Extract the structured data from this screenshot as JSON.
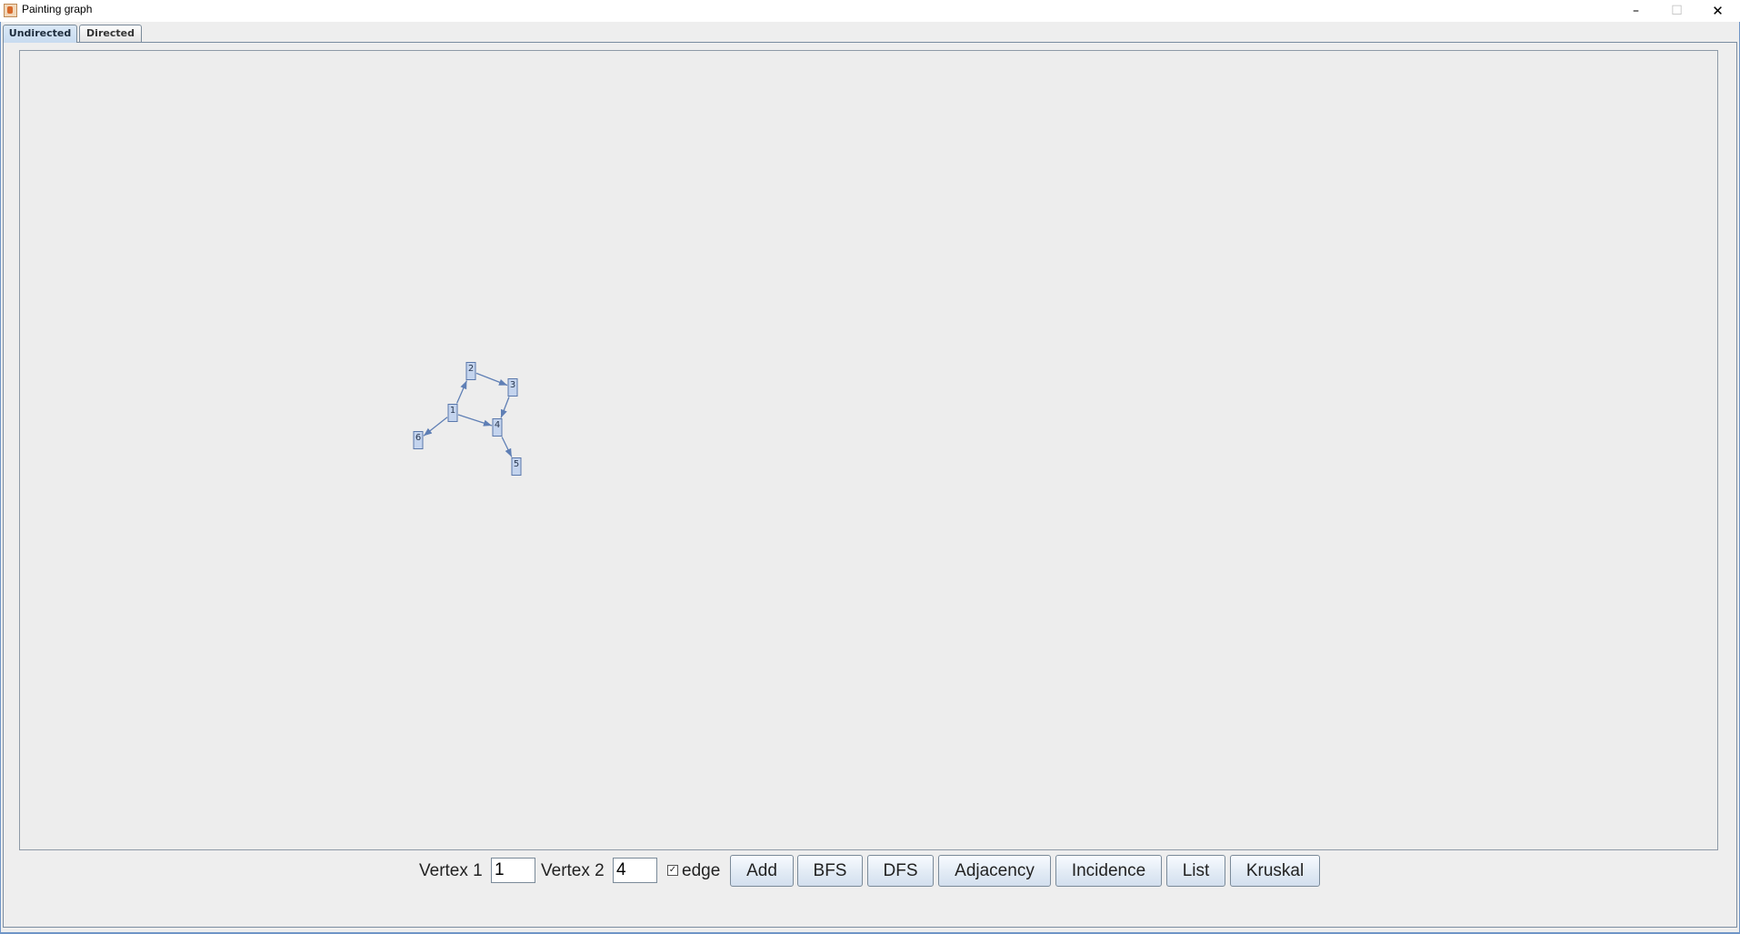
{
  "window": {
    "title": "Painting graph",
    "minimize_glyph": "–",
    "maximize_glyph": "☐",
    "close_glyph": "✕"
  },
  "tabs": [
    {
      "label": "Undirected",
      "selected": true
    },
    {
      "label": "Directed",
      "selected": false
    }
  ],
  "graph": {
    "vertices": [
      "1",
      "2",
      "3",
      "4",
      "5",
      "6"
    ],
    "edges": [
      [
        "1",
        "2"
      ],
      [
        "2",
        "3"
      ],
      [
        "3",
        "4"
      ],
      [
        "1",
        "4"
      ],
      [
        "4",
        "5"
      ],
      [
        "1",
        "6"
      ]
    ],
    "vertex_fill": "#c4d4ee",
    "vertex_border": "#5a78ab",
    "edge_color": "#5f7fb5"
  },
  "controls": {
    "vertex1_label": "Vertex 1",
    "vertex1_value": "1",
    "vertex2_label": "Vertex 2",
    "vertex2_value": "4",
    "edge_checked": true,
    "edge_label": "edge",
    "buttons": [
      "Add",
      "BFS",
      "DFS",
      "Adjacency",
      "Incidence",
      "List",
      "Kruskal"
    ]
  }
}
